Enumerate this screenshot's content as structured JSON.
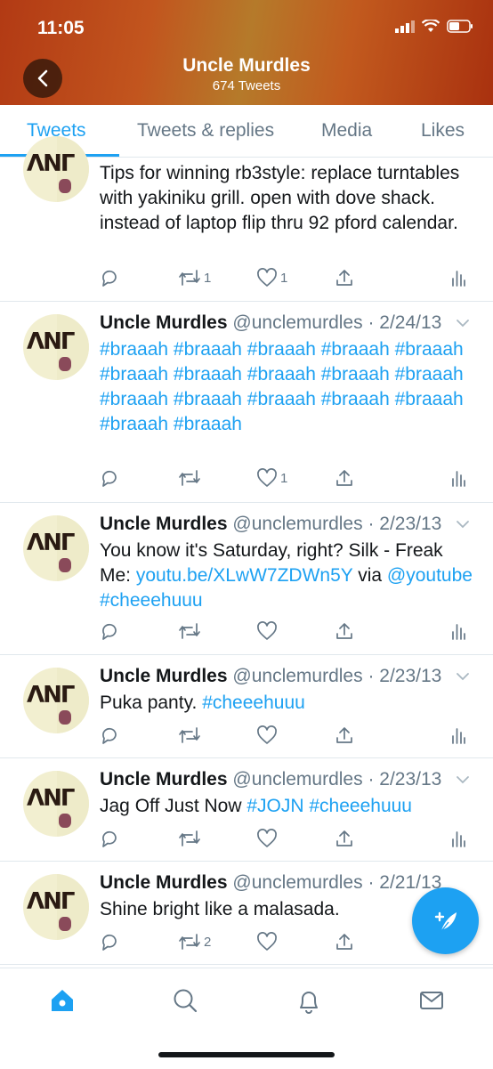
{
  "status": {
    "time": "11:05"
  },
  "header": {
    "title": "Uncle Murdles",
    "subtitle": "674 Tweets"
  },
  "tabs": [
    {
      "label": "Tweets",
      "active": true
    },
    {
      "label": "Tweets & replies",
      "active": false
    },
    {
      "label": "Media",
      "active": false
    },
    {
      "label": "Likes",
      "active": false
    }
  ],
  "tweets": [
    {
      "name": "",
      "handle": "",
      "date": "",
      "body": "Tips for winning rb3style: replace turntables with yakiniku grill. open with dove shack. instead of laptop flip thru 92 pford calendar.",
      "retweets": "1",
      "likes": "1"
    },
    {
      "name": "Uncle Murdles",
      "handle": "@unclemurdles",
      "date": "· 2/24/13",
      "body": "#braaah #braaah #braaah #braaah #braaah #braaah #braaah #braaah #braaah #braaah #braaah #braaah #braaah #braaah #braaah #braaah #braaah",
      "retweets": "",
      "likes": "1"
    },
    {
      "name": "Uncle Murdles",
      "handle": "@unclemurdles",
      "date": "· 2/23/13",
      "body_text": "You know it's Saturday, right? Silk - Freak Me: ",
      "body_link": "youtu.be/XLwW7ZDWn5Y",
      "body_text2": " via ",
      "body_link2": "@youtube #cheeehuuu",
      "retweets": "",
      "likes": ""
    },
    {
      "name": "Uncle Murdles",
      "handle": "@unclemurdles",
      "date": "· 2/23/13",
      "body_text": "Puka panty. ",
      "body_link": "#cheeehuuu",
      "retweets": "",
      "likes": ""
    },
    {
      "name": "Uncle Murdles",
      "handle": "@unclemurdles",
      "date": "· 2/23/13",
      "body_text": "Jag Off Just Now ",
      "body_link": "#JOJN #cheeehuuu",
      "retweets": "",
      "likes": ""
    },
    {
      "name": "Uncle Murdles",
      "handle": "@unclemurdles",
      "date": "· 2/21/13",
      "body": "Shine bright like a malasada.",
      "retweets": "2",
      "likes": ""
    }
  ],
  "avatar_text": "ΛΝΓ",
  "colors": {
    "accent": "#1da1f2",
    "muted": "#657786",
    "border": "#e1e8ed"
  },
  "icons": [
    "back-icon",
    "reply-icon",
    "retweet-icon",
    "like-icon",
    "share-icon",
    "analytics-icon",
    "chevron-down-icon",
    "home-icon",
    "search-icon",
    "notifications-icon",
    "messages-icon",
    "compose-icon"
  ]
}
